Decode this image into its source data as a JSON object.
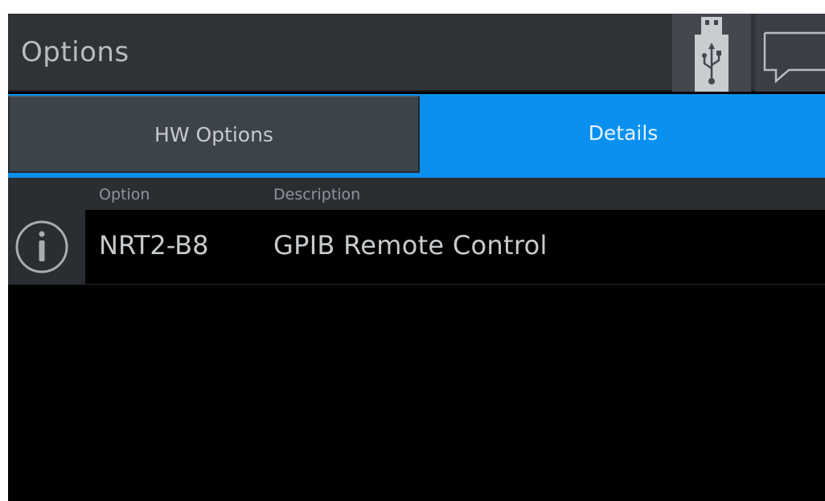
{
  "header": {
    "title": "Options",
    "usb_icon": "usb-icon",
    "message_icon": "message-icon"
  },
  "tabs": [
    {
      "label": "HW Options",
      "active": false
    },
    {
      "label": "Details",
      "active": true
    }
  ],
  "table": {
    "columns": [
      "Option",
      "Description"
    ],
    "rows": [
      {
        "icon": "info-icon",
        "option": "NRT2-B8",
        "description": "GPIB Remote Control"
      }
    ]
  },
  "colors": {
    "header_bg": "#2f3338",
    "accent_blue": "#0a91f0",
    "inactive_tab": "#3d434a",
    "text_light": "#c7cbce"
  }
}
